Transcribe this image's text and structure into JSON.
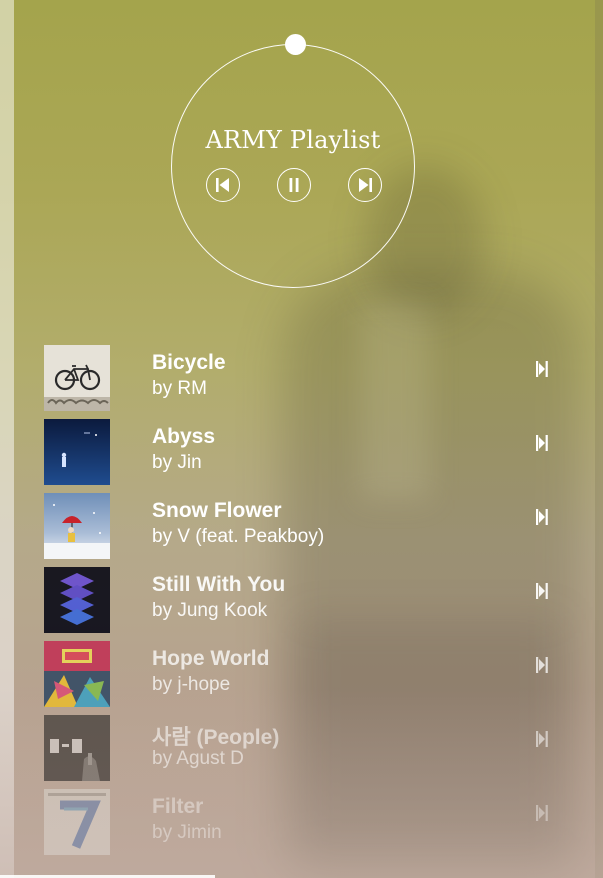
{
  "player": {
    "title": "ARMY Playlist",
    "controls": [
      {
        "icon": "skip-previous-icon"
      },
      {
        "icon": "pause-icon"
      },
      {
        "icon": "skip-next-icon"
      }
    ]
  },
  "tracks": [
    {
      "title": "Bicycle",
      "artist": "by RM",
      "opacity": 1
    },
    {
      "title": "Abyss",
      "artist": "by Jin",
      "opacity": 1
    },
    {
      "title": "Snow Flower",
      "artist": "by V (feat. Peakboy)",
      "opacity": 1
    },
    {
      "title": "Still With You",
      "artist": "by Jung Kook",
      "opacity": 0.92
    },
    {
      "title": "Hope World",
      "artist": "by j-hope",
      "opacity": 0.75
    },
    {
      "title": "사람 (People)",
      "artist": "by Agust D",
      "opacity": 0.55
    },
    {
      "title": "Filter",
      "artist": "by Jimin",
      "opacity": 0.38
    }
  ],
  "colors": {
    "accent": "#ffffff",
    "background_top": "#a4a44c",
    "background_bottom": "#b9a394"
  }
}
